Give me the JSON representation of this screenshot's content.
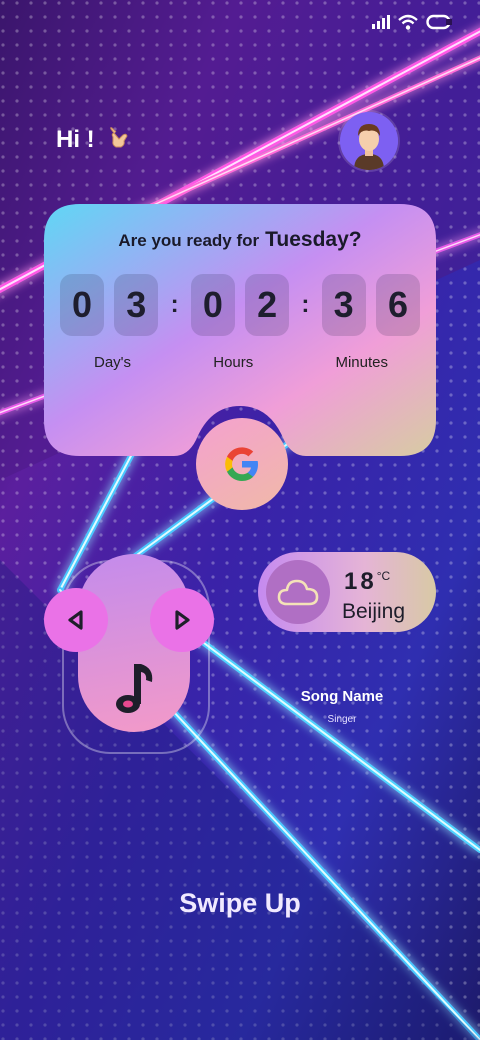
{
  "greeting": {
    "text": "Hi !"
  },
  "countdown": {
    "prompt": "Are you ready for",
    "day": "Tuesday?",
    "digits": [
      "0",
      "3",
      "0",
      "2",
      "3",
      "6"
    ],
    "separator": ":",
    "units": [
      "Day's",
      "Hours",
      "Minutes"
    ]
  },
  "weather": {
    "temp": "18",
    "unit": "°C",
    "city": "Beijing"
  },
  "music": {
    "song": "Song Name",
    "singer": "Singer"
  },
  "swipe": {
    "label": "Swipe Up"
  },
  "icons": {
    "status": [
      "signal-icon",
      "wifi-icon",
      "battery-icon"
    ],
    "google": "google-icon",
    "prev": "previous-icon",
    "next": "next-icon",
    "note": "music-note-icon",
    "cloud": "cloud-icon",
    "wave": "shaka-hand-icon"
  },
  "colors": {
    "accent": "#ea72e7",
    "neon_pink": "#ff4fd8",
    "neon_blue": "#4fd2ff"
  }
}
